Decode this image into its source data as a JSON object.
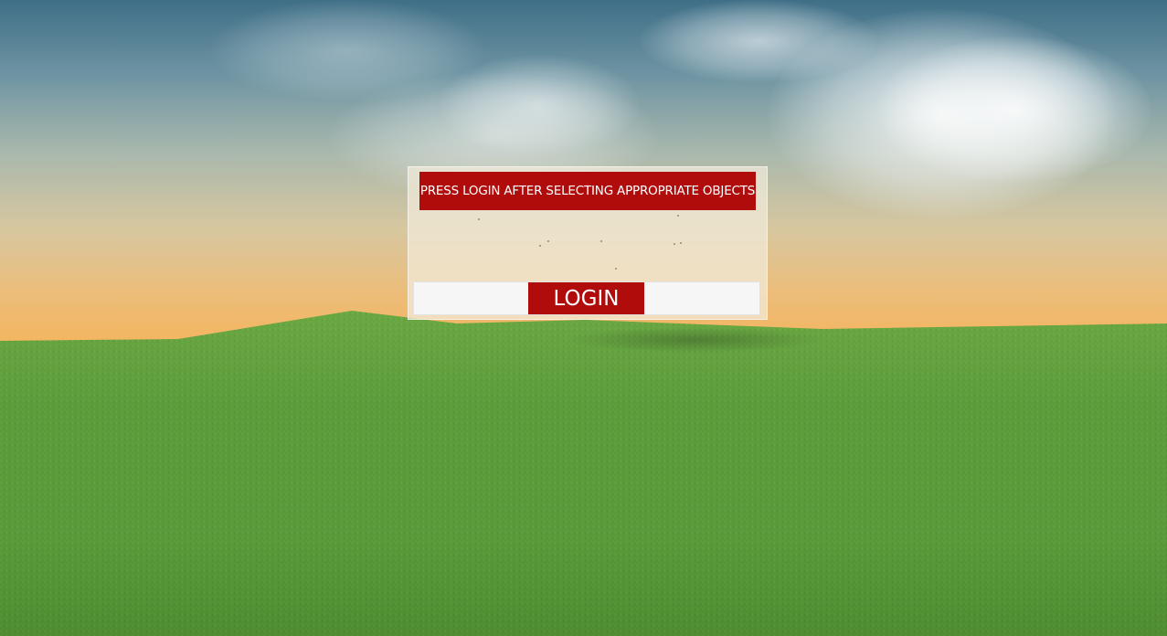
{
  "game": {
    "instruction_banner": "PRESS LOGIN AFTER SELECTING APPROPRIATE OBJECTS",
    "login_label": "LOGIN"
  },
  "colors": {
    "accent_red": "#b00c0c",
    "sky_top": "#3f6f87",
    "horizon_orange": "#f1b25c",
    "grass_green": "#5a9a3a"
  }
}
